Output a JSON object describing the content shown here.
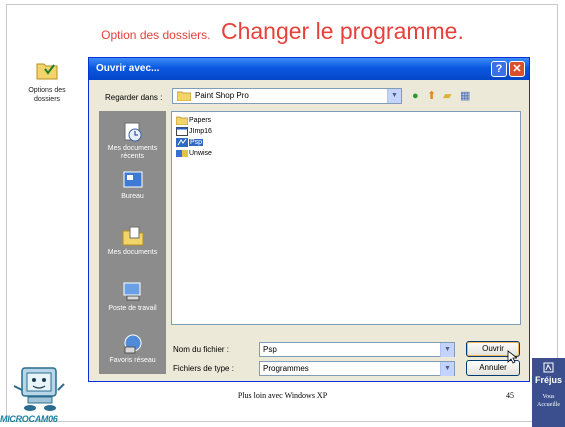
{
  "slide": {
    "title_small": "Option des dossiers.",
    "title_big": "Changer le programme.",
    "footer": "Plus loin avec Windows XP",
    "page_number": "45"
  },
  "desktop_icon": {
    "label": "Options des dossiers",
    "icon": "folder-options-icon"
  },
  "dialog": {
    "title": "Ouvrir avec...",
    "help_glyph": "?",
    "close_glyph": "✕",
    "look_in_label": "Regarder dans :",
    "look_in_value": "Paint Shop Pro",
    "places": [
      {
        "label": "Mes documents récents",
        "icon": "recent-documents-icon"
      },
      {
        "label": "Bureau",
        "icon": "desktop-icon"
      },
      {
        "label": "Mes documents",
        "icon": "my-documents-icon"
      },
      {
        "label": "Poste de travail",
        "icon": "my-computer-icon"
      },
      {
        "label": "Favoris réseau",
        "icon": "network-places-icon"
      }
    ],
    "files": [
      {
        "name": "Papers",
        "icon": "folder-icon"
      },
      {
        "name": "JImp16",
        "icon": "exe-icon"
      },
      {
        "name": "Psp",
        "icon": "psp-icon"
      },
      {
        "name": "Unwise",
        "icon": "unwise-icon"
      }
    ],
    "file_name_label": "Nom du fichier :",
    "file_name_value": "Psp",
    "file_type_label": "Fichiers de type :",
    "file_type_value": "Programmes",
    "open_button": "Ouvrir",
    "cancel_button": "Annuler"
  },
  "logos": {
    "left": "MICROCAM06",
    "right_title": "Fréjus",
    "right_sub": "Vous Accueille"
  },
  "colors": {
    "title_red": "#e8403a",
    "xp_blue": "#0a58e0",
    "selection": "#316ac5"
  }
}
